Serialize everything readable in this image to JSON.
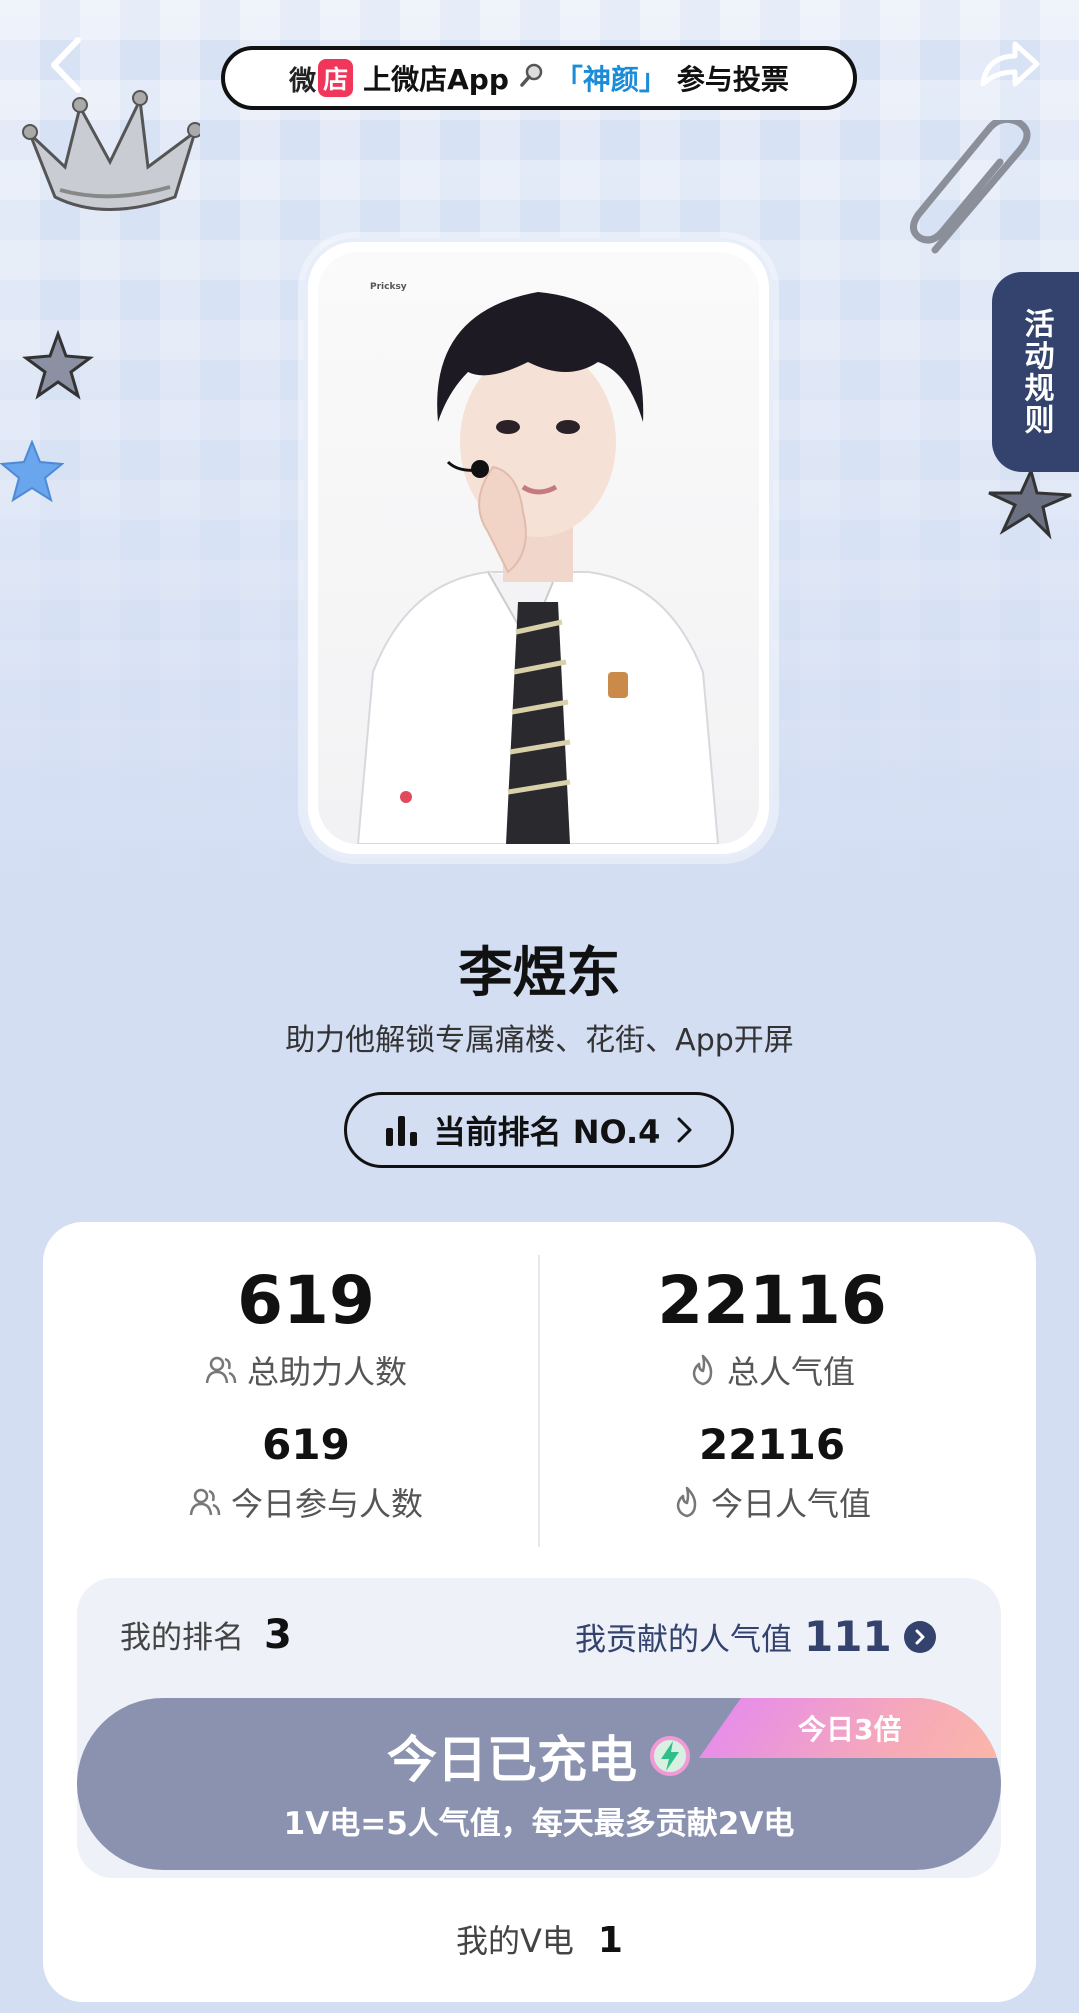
{
  "header": {
    "shop_name": "微",
    "shop_mark": "店",
    "banner_pre": "上微店App",
    "banner_keyword": "「神颜」",
    "banner_post": "参与投票"
  },
  "side_tab": {
    "label": "活动规则"
  },
  "photo": {
    "tag": "Pricksy"
  },
  "candidate": {
    "name": "李煜东",
    "tagline": "助力他解锁专属痛楼、花街、App开屏"
  },
  "ranking": {
    "label": "当前排名 NO.4"
  },
  "stats": {
    "total_supporters": "619",
    "total_supporters_label": "总助力人数",
    "today_participants": "619",
    "today_participants_label": "今日参与人数",
    "total_popularity": "22116",
    "total_popularity_label": "总人气值",
    "today_popularity": "22116",
    "today_popularity_label": "今日人气值"
  },
  "my": {
    "rank_label": "我的排名",
    "rank_value": "3",
    "contrib_label": "我贡献的人气值",
    "contrib_value": "111",
    "v_label": "我的V电",
    "v_value": "1"
  },
  "charge": {
    "title": "今日已充电",
    "subtitle": "1V电=5人气值，每天最多贡献2V电",
    "badge": "今日3倍"
  },
  "colors": {
    "accent_navy": "#33436e",
    "highlight_blue": "#1a8cd8",
    "shop_red": "#f0365a",
    "charge_gray": "#8b92b0"
  }
}
